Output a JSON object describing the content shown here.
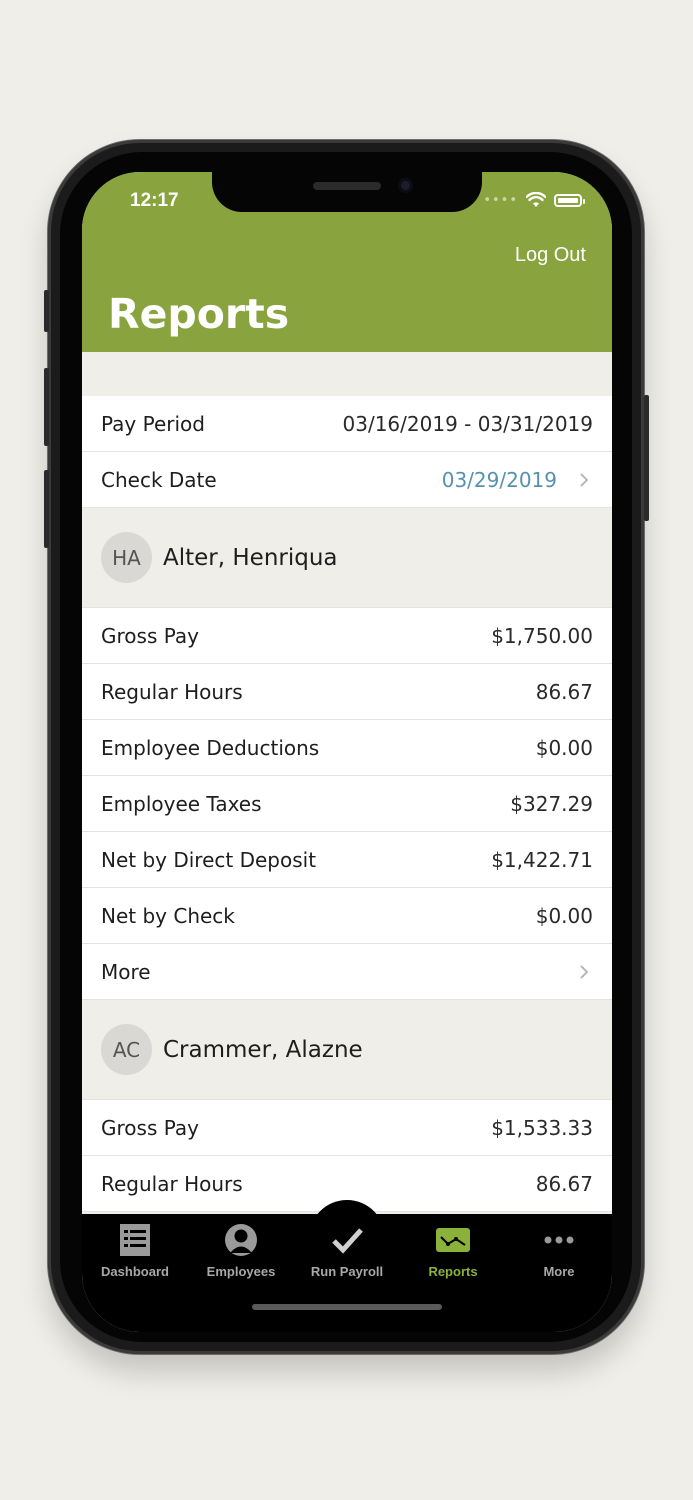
{
  "status_bar": {
    "time": "12:17"
  },
  "header": {
    "logout_label": "Log Out",
    "title": "Reports"
  },
  "pay_info": {
    "pay_period_label": "Pay Period",
    "pay_period_value": "03/16/2019 - 03/31/2019",
    "check_date_label": "Check Date",
    "check_date_value": "03/29/2019"
  },
  "employees": [
    {
      "initials": "HA",
      "name": "Alter, Henriqua",
      "rows": [
        {
          "label": "Gross Pay",
          "value": "$1,750.00"
        },
        {
          "label": "Regular Hours",
          "value": "86.67"
        },
        {
          "label": "Employee Deductions",
          "value": "$0.00"
        },
        {
          "label": "Employee Taxes",
          "value": "$327.29"
        },
        {
          "label": "Net by Direct Deposit",
          "value": "$1,422.71"
        },
        {
          "label": "Net by Check",
          "value": "$0.00"
        }
      ],
      "more_label": "More"
    },
    {
      "initials": "AC",
      "name": "Crammer, Alazne",
      "rows": [
        {
          "label": "Gross Pay",
          "value": "$1,533.33"
        },
        {
          "label": "Regular Hours",
          "value": "86.67"
        }
      ]
    }
  ],
  "tabbar": {
    "items": [
      {
        "label": "Dashboard",
        "icon": "list-icon"
      },
      {
        "label": "Employees",
        "icon": "person-icon"
      },
      {
        "label": "Run Payroll",
        "icon": "checkmark-icon"
      },
      {
        "label": "Reports",
        "icon": "chart-icon",
        "active": true
      },
      {
        "label": "More",
        "icon": "more-dots-icon"
      }
    ]
  },
  "colors": {
    "header_green": "#89a33e",
    "active_tab": "#8ab23b",
    "link_blue": "#5592b0",
    "background": "#efeee9"
  }
}
